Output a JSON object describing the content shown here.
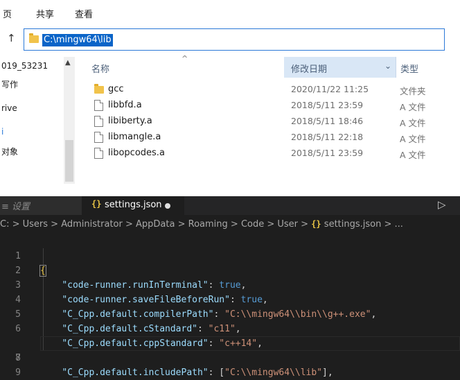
{
  "explorer": {
    "ribbon_tabs": [
      "页",
      "共享",
      "查看"
    ],
    "address": "C:\\mingw64\\lib",
    "nav_items": [
      "019_53231",
      "写作",
      "rive",
      "i",
      "对象"
    ],
    "columns": {
      "name": "名称",
      "date": "修改日期",
      "type": "类型"
    },
    "files": [
      {
        "name": "gcc",
        "date": "2020/11/22 11:25",
        "type": "文件夹",
        "icon": "folder-icon"
      },
      {
        "name": "libbfd.a",
        "date": "2018/5/11 23:59",
        "type": "A 文件",
        "icon": "file-icon"
      },
      {
        "name": "libiberty.a",
        "date": "2018/5/11 18:46",
        "type": "A 文件",
        "icon": "file-icon"
      },
      {
        "name": "libmangle.a",
        "date": "2018/5/11 22:18",
        "type": "A 文件",
        "icon": "file-icon"
      },
      {
        "name": "libopcodes.a",
        "date": "2018/5/11 23:59",
        "type": "A 文件",
        "icon": "file-icon"
      }
    ],
    "accent_color": "#0a64c8"
  },
  "vscode": {
    "tabs": {
      "settings_ui": "≡ 设置",
      "json": "settings.json",
      "json_icon": "{}"
    },
    "breadcrumb": [
      "C:",
      "Users",
      "Administrator",
      "AppData",
      "Roaming",
      "Code",
      "User",
      "settings.json",
      "..."
    ],
    "lines": [
      {
        "n": "1",
        "open": "{"
      },
      {
        "n": "2",
        "key": "\"code-runner.runInTerminal\"",
        "val": "true",
        "val_type": "bool",
        "tail": ","
      },
      {
        "n": "3",
        "key": "\"code-runner.saveFileBeforeRun\"",
        "val": "true",
        "val_type": "bool",
        "tail": ","
      },
      {
        "n": "4",
        "key": "\"C_Cpp.default.compilerPath\"",
        "val": "\"C:\\\\mingw64\\\\bin\\\\g++.exe\"",
        "val_type": "string",
        "tail": ","
      },
      {
        "n": "5",
        "key": "\"C_Cpp.default.cStandard\"",
        "val": "\"c11\"",
        "val_type": "string",
        "tail": ","
      },
      {
        "n": "6",
        "key": "\"C_Cpp.default.cppStandard\"",
        "val": "\"c++14\"",
        "val_type": "string",
        "tail": ","
      },
      {
        "n": "7",
        "key": "\"C_Cpp.default.includePath\"",
        "val_prefix": "[",
        "val": "\"C:\\\\mingw64\\\\lib\"",
        "val_type": "string",
        "tail": "],",
        "tail_pre": "]"
      },
      {
        "n": "8"
      },
      {
        "n": "9",
        "open": "}"
      }
    ],
    "colors": {
      "background": "#1e1e1e",
      "key": "#9cdcfe",
      "string": "#ce9178",
      "keyword": "#569cd6"
    }
  }
}
